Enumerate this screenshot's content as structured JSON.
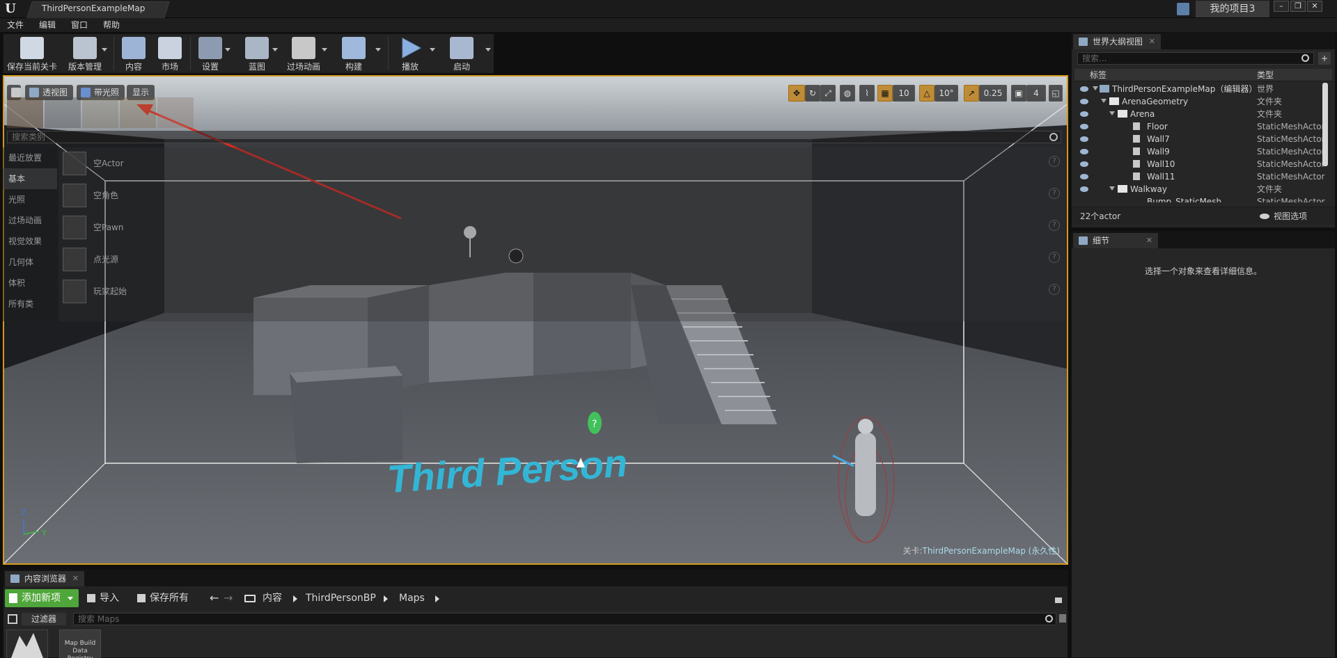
{
  "app": {
    "logo": "U",
    "doc_tab": "ThirdPersonExampleMap",
    "project": "我的项目3",
    "win_minimize": "–",
    "win_restore": "❐",
    "win_close": "✕"
  },
  "menu": [
    "文件",
    "编辑",
    "窗口",
    "帮助"
  ],
  "toolbar": {
    "buttons": [
      {
        "label": "保存当前关卡",
        "icon": "save-icon",
        "color": "#cfd8e3"
      },
      {
        "label": "版本管理",
        "icon": "source-control-icon",
        "color": "#b9c4d0"
      },
      {
        "label": "内容",
        "icon": "content-icon",
        "color": "#9db4d6"
      },
      {
        "label": "市场",
        "icon": "marketplace-icon",
        "color": "#c9d2de"
      },
      {
        "label": "设置",
        "icon": "settings-icon",
        "color": "#8c9bb0"
      },
      {
        "label": "蓝图",
        "icon": "blueprint-icon",
        "color": "#aab6c6"
      },
      {
        "label": "过场动画",
        "icon": "cinematics-icon",
        "color": "#c8c8c8"
      },
      {
        "label": "构建",
        "icon": "build-icon",
        "color": "#9fb8dc"
      },
      {
        "label": "播放",
        "icon": "play-icon",
        "color": "#8ab0e0"
      },
      {
        "label": "启动",
        "icon": "launch-icon",
        "color": "#a8b8d0"
      }
    ]
  },
  "viewport": {
    "perspective": "透视图",
    "lit": "带光照",
    "show": "显示",
    "grid_snap": "10",
    "rotation_snap": "10°",
    "scale_snap": "0.25",
    "camera_speed": "4",
    "level_prefix": "关卡:",
    "level_name": "ThirdPersonExampleMap (永久性)",
    "floor_text": "Third Person",
    "accent": "#d49a1c"
  },
  "place_modes": {
    "search_placeholder": "搜索类别",
    "categories": [
      "最近放置",
      "基本",
      "光照",
      "过场动画",
      "视觉效果",
      "几何体",
      "体积",
      "所有类"
    ],
    "active_category": "基本",
    "items": [
      "空Actor",
      "空角色",
      "空Pawn",
      "点光源",
      "玩家起始"
    ],
    "help": "?"
  },
  "outliner": {
    "tab": "世界大纲视图",
    "close": "✕",
    "search_placeholder": "搜索...",
    "add": "+",
    "col_label": "标签",
    "col_type": "类型",
    "rows": [
      {
        "label": "ThirdPersonExampleMap（编辑器）",
        "type": "世界"
      },
      {
        "label": "ArenaGeometry",
        "type": "文件夹"
      },
      {
        "label": "Arena",
        "type": "文件夹"
      },
      {
        "label": "Floor",
        "type": "StaticMeshActor"
      },
      {
        "label": "Wall7",
        "type": "StaticMeshActor"
      },
      {
        "label": "Wall9",
        "type": "StaticMeshActor"
      },
      {
        "label": "Wall10",
        "type": "StaticMeshActor"
      },
      {
        "label": "Wall11",
        "type": "StaticMeshActor"
      },
      {
        "label": "Walkway",
        "type": "文件夹"
      },
      {
        "label": "Bump_StaticMesh",
        "type": "StaticMeshActor"
      }
    ],
    "actor_count": "22个actor",
    "view_options": "视图选项"
  },
  "details": {
    "tab": "细节",
    "close": "✕",
    "message": "选择一个对象来查看详细信息。"
  },
  "content_browser": {
    "tab": "内容浏览器",
    "close": "✕",
    "add_new": "添加新项",
    "import": "导入",
    "save_all": "保存所有",
    "back": "←",
    "forward": "→",
    "path": [
      "内容",
      "ThirdPersonBP",
      "Maps"
    ],
    "filters": "过滤器",
    "search_placeholder": "搜索 Maps",
    "assets": [
      "Map Build Data Registry"
    ]
  }
}
